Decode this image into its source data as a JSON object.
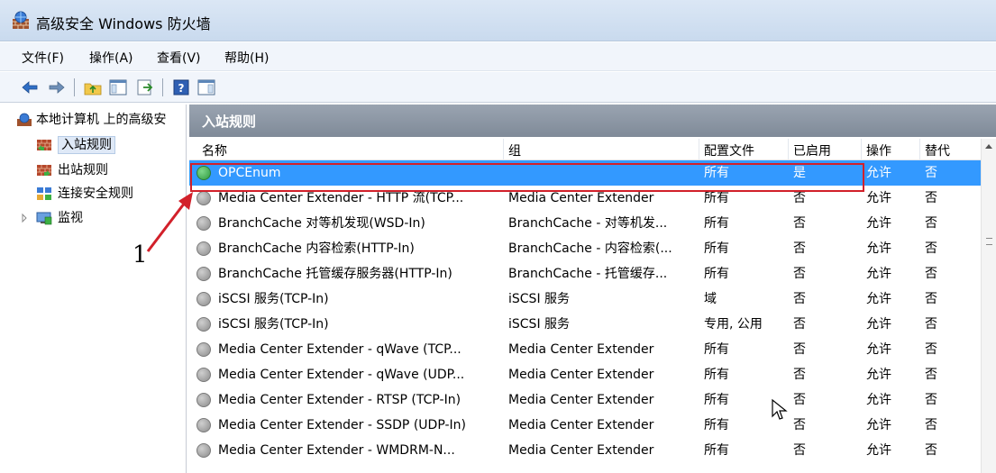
{
  "window": {
    "title": "高级安全 Windows 防火墙"
  },
  "menu": [
    {
      "label": "文件(F)"
    },
    {
      "label": "操作(A)"
    },
    {
      "label": "查看(V)"
    },
    {
      "label": "帮助(H)"
    }
  ],
  "toolbar": {
    "icons": [
      "back-icon",
      "forward-icon",
      "up-folder-icon",
      "show-hide-console-tree-icon",
      "export-list-icon",
      "help-icon",
      "show-hide-action-pane-icon"
    ]
  },
  "tree": {
    "root": "本地计算机 上的高级安",
    "items": [
      {
        "label": "入站规则",
        "selected": true
      },
      {
        "label": "出站规则"
      },
      {
        "label": "连接安全规则"
      },
      {
        "label": "监视",
        "expandable": true
      }
    ]
  },
  "pane": {
    "title": "入站规则",
    "columns": [
      "名称",
      "组",
      "配置文件",
      "已启用",
      "操作",
      "替代"
    ],
    "rows": [
      {
        "name": "OPCEnum",
        "group": "",
        "profile": "所有",
        "enabled": "是",
        "action": "允许",
        "override": "否",
        "status": "enabled",
        "selected": true
      },
      {
        "name": "Media Center Extender - HTTP 流(TCP...",
        "group": "Media Center Extender",
        "profile": "所有",
        "enabled": "否",
        "action": "允许",
        "override": "否",
        "status": "disabled"
      },
      {
        "name": "BranchCache 对等机发现(WSD-In)",
        "group": "BranchCache - 对等机发...",
        "profile": "所有",
        "enabled": "否",
        "action": "允许",
        "override": "否",
        "status": "disabled"
      },
      {
        "name": "BranchCache 内容检索(HTTP-In)",
        "group": "BranchCache - 内容检索(...",
        "profile": "所有",
        "enabled": "否",
        "action": "允许",
        "override": "否",
        "status": "disabled"
      },
      {
        "name": "BranchCache 托管缓存服务器(HTTP-In)",
        "group": "BranchCache - 托管缓存...",
        "profile": "所有",
        "enabled": "否",
        "action": "允许",
        "override": "否",
        "status": "disabled"
      },
      {
        "name": "iSCSI 服务(TCP-In)",
        "group": "iSCSI 服务",
        "profile": "域",
        "enabled": "否",
        "action": "允许",
        "override": "否",
        "status": "disabled"
      },
      {
        "name": "iSCSI 服务(TCP-In)",
        "group": "iSCSI 服务",
        "profile": "专用, 公用",
        "enabled": "否",
        "action": "允许",
        "override": "否",
        "status": "disabled"
      },
      {
        "name": "Media Center Extender - qWave (TCP...",
        "group": "Media Center Extender",
        "profile": "所有",
        "enabled": "否",
        "action": "允许",
        "override": "否",
        "status": "disabled"
      },
      {
        "name": "Media Center Extender - qWave (UDP...",
        "group": "Media Center Extender",
        "profile": "所有",
        "enabled": "否",
        "action": "允许",
        "override": "否",
        "status": "disabled"
      },
      {
        "name": "Media Center Extender - RTSP (TCP-In)",
        "group": "Media Center Extender",
        "profile": "所有",
        "enabled": "否",
        "action": "允许",
        "override": "否",
        "status": "disabled"
      },
      {
        "name": "Media Center Extender - SSDP (UDP-In)",
        "group": "Media Center Extender",
        "profile": "所有",
        "enabled": "否",
        "action": "允许",
        "override": "否",
        "status": "disabled"
      },
      {
        "name": "Media Center Extender - WMDRM-N...",
        "group": "Media Center Extender",
        "profile": "所有",
        "enabled": "否",
        "action": "允许",
        "override": "否",
        "status": "disabled"
      }
    ]
  },
  "annotation": {
    "label": "1",
    "color": "#d2202a"
  }
}
